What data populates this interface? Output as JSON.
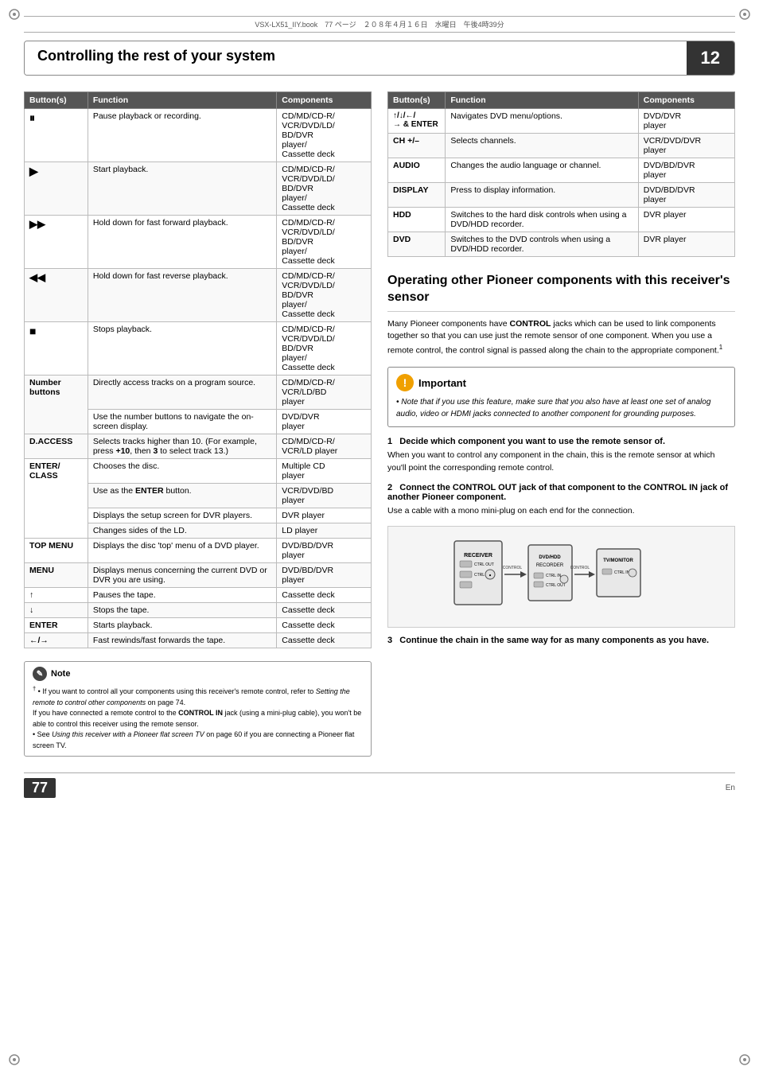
{
  "file_info": "VSX-LX51_IIY.book　77 ページ　２０８年４月１６日　水曜日　午後4時39分",
  "header": {
    "title": "Controlling the rest of your system",
    "chapter": "12"
  },
  "left_table": {
    "headers": [
      "Button(s)",
      "Function",
      "Components"
    ],
    "rows": [
      {
        "button": "⏸",
        "button_symbol": "pause",
        "function": "Pause playback or recording.",
        "components": "CD/MD/CD-R/\nVCR/DVD/LD/\nBD/DVR\nplayer/\nCassette deck"
      },
      {
        "button": "▶",
        "button_symbol": "play",
        "function": "Start playback.",
        "components": "CD/MD/CD-R/\nVCR/DVD/LD/\nBD/DVR\nplayer/\nCassette deck"
      },
      {
        "button": "▶▶",
        "button_symbol": "fast-forward",
        "function": "Hold down for fast forward playback.",
        "components": "CD/MD/CD-R/\nVCR/DVD/LD/\nBD/DVR\nplayer/\nCassette deck"
      },
      {
        "button": "◀◀",
        "button_symbol": "fast-reverse",
        "function": "Hold down for fast reverse playback.",
        "components": "CD/MD/CD-R/\nVCR/DVD/LD/\nBD/DVR\nplayer/\nCassette deck"
      },
      {
        "button": "■",
        "button_symbol": "stop",
        "function": "Stops playback.",
        "components": "CD/MD/CD-R/\nVCR/DVD/LD/\nBD/DVR\nplayer/\nCassette deck"
      },
      {
        "button": "Number\nbuttons",
        "button_symbol": "number-buttons",
        "function": "Directly access tracks on a program source.",
        "components": "CD/MD/CD-R/\nVCR/LD/BD\nplayer",
        "sub_rows": [
          {
            "function": "Use the number buttons to navigate the on-screen display.",
            "components": "DVD/DVR\nplayer"
          }
        ]
      },
      {
        "button": "D.ACCESS",
        "button_symbol": "d-access",
        "function": "Selects tracks higher than 10. (For example, press +10, then 3 to select track 13.)",
        "components": "CD/MD/CD-R/\nVCR/LD player"
      },
      {
        "button": "ENTER/\nCLASS",
        "button_symbol": "enter-class",
        "function": "Chooses the disc.",
        "components": "Multiple CD\nplayer",
        "sub_rows": [
          {
            "function": "Use as the ENTER button.",
            "components": "VCR/DVD/BD\nplayer"
          },
          {
            "function": "Displays the setup screen for DVR players.",
            "components": "DVR player"
          },
          {
            "function": "Changes sides of the LD.",
            "components": "LD player"
          }
        ]
      },
      {
        "button": "TOP MENU",
        "button_symbol": "top-menu",
        "function": "Displays the disc 'top' menu of a DVD player.",
        "components": "DVD/BD/DVR\nplayer"
      },
      {
        "button": "MENU",
        "button_symbol": "menu",
        "function": "Displays menus concerning the current DVD or DVR you are using.",
        "components": "DVD/BD/DVR\nplayer"
      },
      {
        "button": "↑",
        "button_symbol": "up-arrow",
        "function": "Pauses the tape.",
        "components": "Cassette deck"
      },
      {
        "button": "↓",
        "button_symbol": "down-arrow",
        "function": "Stops the tape.",
        "components": "Cassette deck"
      },
      {
        "button": "ENTER",
        "button_symbol": "enter",
        "function": "Starts playback.",
        "components": "Cassette deck"
      },
      {
        "button": "←/→",
        "button_symbol": "left-right",
        "function": "Fast rewinds/fast forwards the tape.",
        "components": "Cassette deck"
      }
    ]
  },
  "right_table": {
    "headers": [
      "Button(s)",
      "Function",
      "Components"
    ],
    "rows": [
      {
        "button": "↑/↓/←/ → & ENTER",
        "button_symbol": "nav-enter",
        "function": "Navigates DVD menu/options.",
        "components": "DVD/DVR\nplayer"
      },
      {
        "button": "CH +/–",
        "button_symbol": "ch-plus-minus",
        "function": "Selects channels.",
        "components": "VCR/DVD/DVR\nplayer"
      },
      {
        "button": "AUDIO",
        "button_symbol": "audio",
        "function": "Changes the audio language or channel.",
        "components": "DVD/BD/DVR\nplayer"
      },
      {
        "button": "DISPLAY",
        "button_symbol": "display",
        "function": "Press to display information.",
        "components": "DVD/BD/DVR\nplayer"
      },
      {
        "button": "HDD",
        "button_symbol": "hdd",
        "function": "Switches to the hard disk controls when using a DVD/HDD recorder.",
        "components": "DVR player"
      },
      {
        "button": "DVD",
        "button_symbol": "dvd",
        "function": "Switches to the DVD controls when using a DVD/HDD recorder.",
        "components": "DVR player"
      }
    ]
  },
  "operating_section": {
    "title": "Operating other Pioneer components with this receiver's sensor",
    "body": "Many Pioneer components have CONTROL jacks which can be used to link components together so that you can use just the remote sensor of one component. When you use a remote control, the control signal is passed along the chain to the appropriate component.",
    "footnote": "1"
  },
  "important_box": {
    "header": "Important",
    "bullet": "Note that if you use this feature, make sure that you also have at least one set of analog audio, video or HDMI jacks connected to another component for grounding purposes."
  },
  "steps": [
    {
      "number": "1",
      "heading": "Decide which component you want to use the remote sensor of.",
      "body": "When you want to control any component in the chain, this is the remote sensor at which you'll point the corresponding remote control."
    },
    {
      "number": "2",
      "heading": "Connect the CONTROL OUT jack of that component to the CONTROL IN jack of another Pioneer component.",
      "body": "Use a cable with a mono mini-plug on each end for the connection."
    },
    {
      "number": "3",
      "heading": "Continue the chain in the same way for as many components as you have.",
      "body": ""
    }
  ],
  "note": {
    "header": "Note",
    "lines": [
      "† • If you want to control all your components using this receiver's remote control, refer to Setting the remote to control other components on page 74.",
      "If you have connected a remote control to the CONTROL IN jack (using a mini-plug cable), you won't be able to control this receiver using the remote sensor.",
      "• See Using this receiver with a Pioneer flat screen TV on page 60 if you are connecting a Pioneer flat screen TV."
    ]
  },
  "page_number": "77",
  "page_lang": "En"
}
